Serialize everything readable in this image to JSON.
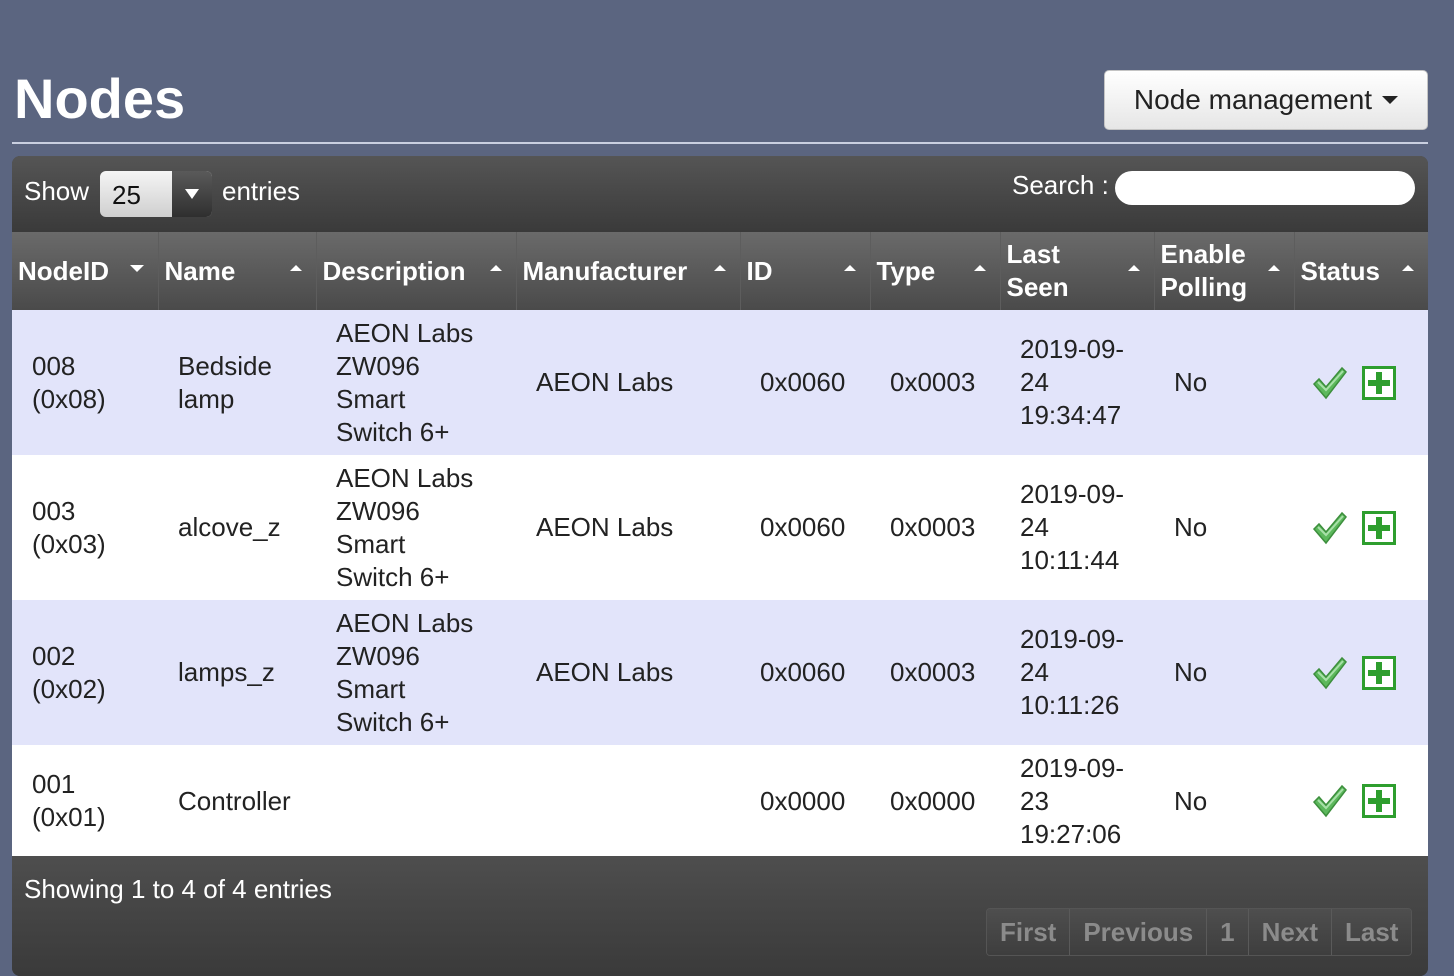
{
  "page": {
    "title": "Nodes"
  },
  "management": {
    "label": "Node management"
  },
  "length": {
    "show_label": "Show",
    "value": "25",
    "entries_label": "entries"
  },
  "search": {
    "label": "Search :",
    "value": ""
  },
  "columns": [
    {
      "label_1": "NodeID",
      "label_2": ""
    },
    {
      "label_1": "Name",
      "label_2": ""
    },
    {
      "label_1": "Description",
      "label_2": ""
    },
    {
      "label_1": "Manufacturer",
      "label_2": ""
    },
    {
      "label_1": "ID",
      "label_2": ""
    },
    {
      "label_1": "Type",
      "label_2": ""
    },
    {
      "label_1": "Last",
      "label_2": "Seen"
    },
    {
      "label_1": "Enable",
      "label_2": "Polling"
    },
    {
      "label_1": "Status",
      "label_2": ""
    }
  ],
  "rows": [
    {
      "node_a": "008",
      "node_b": "(0x08)",
      "name_a": "Bedside",
      "name_b": "lamp",
      "desc": [
        "AEON Labs",
        "ZW096",
        "Smart",
        "Switch 6+"
      ],
      "manufacturer": "AEON Labs",
      "id": "0x0060",
      "type": "0x0003",
      "seen": [
        "2019-09-",
        "24",
        "19:34:47"
      ],
      "polling": "No"
    },
    {
      "node_a": "003",
      "node_b": "(0x03)",
      "name_a": "alcove_z",
      "name_b": "",
      "desc": [
        "AEON Labs",
        "ZW096",
        "Smart",
        "Switch 6+"
      ],
      "manufacturer": "AEON Labs",
      "id": "0x0060",
      "type": "0x0003",
      "seen": [
        "2019-09-",
        "24",
        "10:11:44"
      ],
      "polling": "No"
    },
    {
      "node_a": "002",
      "node_b": "(0x02)",
      "name_a": "lamps_z",
      "name_b": "",
      "desc": [
        "AEON Labs",
        "ZW096",
        "Smart",
        "Switch 6+"
      ],
      "manufacturer": "AEON Labs",
      "id": "0x0060",
      "type": "0x0003",
      "seen": [
        "2019-09-",
        "24",
        "10:11:26"
      ],
      "polling": "No"
    },
    {
      "node_a": "001",
      "node_b": "(0x01)",
      "name_a": "Controller",
      "name_b": "",
      "desc": [
        "",
        "",
        "",
        ""
      ],
      "manufacturer": "",
      "id": "0x0000",
      "type": "0x0000",
      "seen": [
        "2019-09-",
        "23",
        "19:27:06"
      ],
      "polling": "No"
    }
  ],
  "icons": {
    "status": "check-icon",
    "action": "plus-icon",
    "check_color": "#5cb85c",
    "plus_color": "#2e9e2e"
  },
  "footer": {
    "info": "Showing 1 to 4 of 4 entries",
    "first": "First",
    "previous": "Previous",
    "page": "1",
    "next": "Next",
    "last": "Last"
  }
}
